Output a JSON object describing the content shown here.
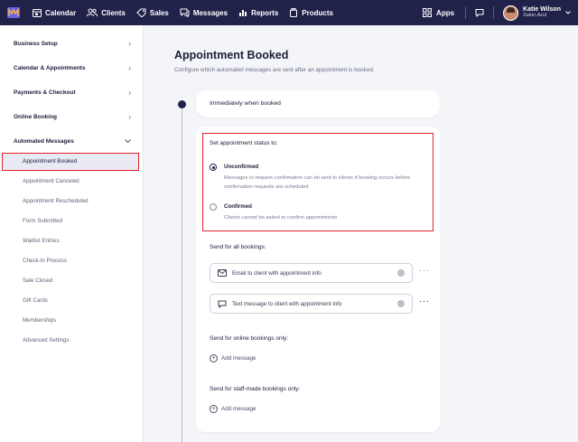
{
  "nav": {
    "items": [
      {
        "label": "Calendar",
        "icon": "calendar-icon"
      },
      {
        "label": "Clients",
        "icon": "clients-icon"
      },
      {
        "label": "Sales",
        "icon": "tag-icon"
      },
      {
        "label": "Messages",
        "icon": "messages-icon"
      },
      {
        "label": "Reports",
        "icon": "reports-icon"
      },
      {
        "label": "Products",
        "icon": "products-icon"
      }
    ],
    "apps_label": "Apps",
    "user_name": "Katie Wilson",
    "user_salon": "Salon Azul"
  },
  "sidebar": {
    "sections": [
      "Business Setup",
      "Calendar & Appointments",
      "Payments & Checkout",
      "Online Booking",
      "Automated Messages"
    ],
    "sub_items": [
      "Appointment Booked",
      "Appointment Canceled",
      "Appointment Rescheduled",
      "Form Submitted",
      "Waitlist Entries",
      "Check-In Process",
      "Sale Closed",
      "Gift Cards",
      "Memberships",
      "Advanced Settings"
    ]
  },
  "main": {
    "title": "Appointment Booked",
    "subtitle": "Configure which automated messages are sent after an appointment is booked.",
    "trigger_label": "Immediately when booked",
    "status_label": "Set appointment status to:",
    "options": [
      {
        "title": "Unconfirmed",
        "desc": "Messages to request confirmation can be sent to clients if booking occurs before confirmation requests are scheduled",
        "selected": true
      },
      {
        "title": "Confirmed",
        "desc": "Clients cannot be asked to confirm appointments",
        "selected": false
      }
    ],
    "all_bookings_label": "Send for all bookings:",
    "messages": [
      {
        "label": "Email to client with appointment info",
        "icon": "mail-icon"
      },
      {
        "label": "Text message to client with appointment info",
        "icon": "chat-bubble-icon"
      }
    ],
    "online_label": "Send for online bookings only:",
    "staff_label": "Send for staff-made bookings only:",
    "add_message_label": "Add message"
  },
  "colors": {
    "nav_bg": "#21224a",
    "highlight": "#e0242c"
  }
}
